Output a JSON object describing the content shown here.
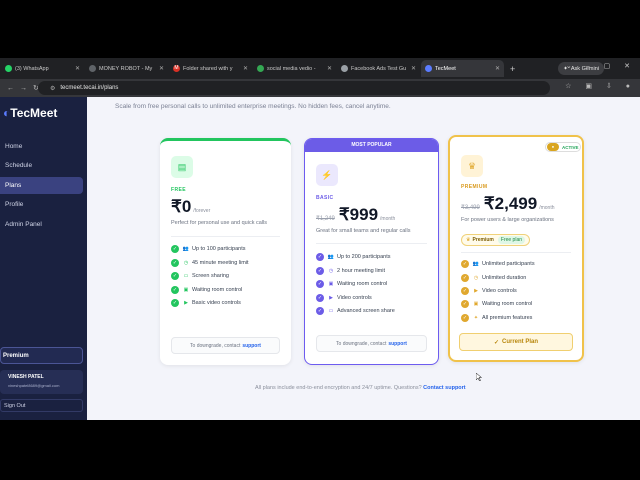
{
  "browser": {
    "tabs": [
      {
        "label": "(3) WhatsApp",
        "color": "#25d366"
      },
      {
        "label": "MONEY ROBOT - My",
        "color": "#5f6368"
      },
      {
        "label": "Folder shared with y",
        "color": "#d93025"
      },
      {
        "label": "social media vedio - ",
        "color": "#34a853"
      },
      {
        "label": "Facebook Ads Test Gu",
        "color": "#9aa0a6"
      },
      {
        "label": "TecMeet",
        "color": "#5b7cff"
      }
    ],
    "new_tab": "+",
    "ask_gemini": "Ask Gemini",
    "url": "tecmeet.tecai.in/plans"
  },
  "sidebar": {
    "logo": "TecMeet",
    "logo_sub": "",
    "items": [
      {
        "label": "Home"
      },
      {
        "label": "Schedule"
      },
      {
        "label": "Plans"
      },
      {
        "label": "Profile"
      },
      {
        "label": "Admin Panel"
      }
    ],
    "premium_label": "Premium",
    "user_name": "VINESH PATEL",
    "user_email": "vineshpatel8689@gmail.com",
    "signout": "Sign Out"
  },
  "main": {
    "subtitle": "Scale from free personal calls to unlimited enterprise meetings. No hidden fees, cancel anytime.",
    "bottom_note": "All plans include end-to-end encryption and 24/7 uptime. Questions?",
    "bottom_link": "Contact support"
  },
  "plans": {
    "free": {
      "tier": "FREE",
      "price": "₹0",
      "period": "/forever",
      "desc": "Perfect for personal use and quick calls",
      "features": [
        "Up to 100 participants",
        "45 minute meeting limit",
        "Screen sharing",
        "Waiting room control",
        "Basic video controls"
      ],
      "footer_text": "To downgrade, contact",
      "footer_link": "support",
      "accent": "#22c55e"
    },
    "basic": {
      "banner": "MOST POPULAR",
      "tier": "BASIC",
      "old_price": "₹1,249",
      "price": "₹999",
      "period": "/month",
      "desc": "Great for small teams and regular calls",
      "features": [
        "Up to 200 participants",
        "2 hour meeting limit",
        "Waiting room control",
        "Video controls",
        "Advanced screen share"
      ],
      "footer_text": "To downgrade, contact",
      "footer_link": "support",
      "accent": "#6c5ce7"
    },
    "premium": {
      "badge": "ACTIVE",
      "tier": "PREMIUM",
      "old_price": "₹3,499",
      "price": "₹2,499",
      "period": "/month",
      "desc": "For power users & large organizations",
      "pill_main": "Premium",
      "pill_sub": "Free plan",
      "features": [
        "Unlimited participants",
        "Unlimited duration",
        "Video controls",
        "Waiting room control",
        "All premium features"
      ],
      "button": "Current Plan",
      "accent": "#e0a82e"
    }
  }
}
